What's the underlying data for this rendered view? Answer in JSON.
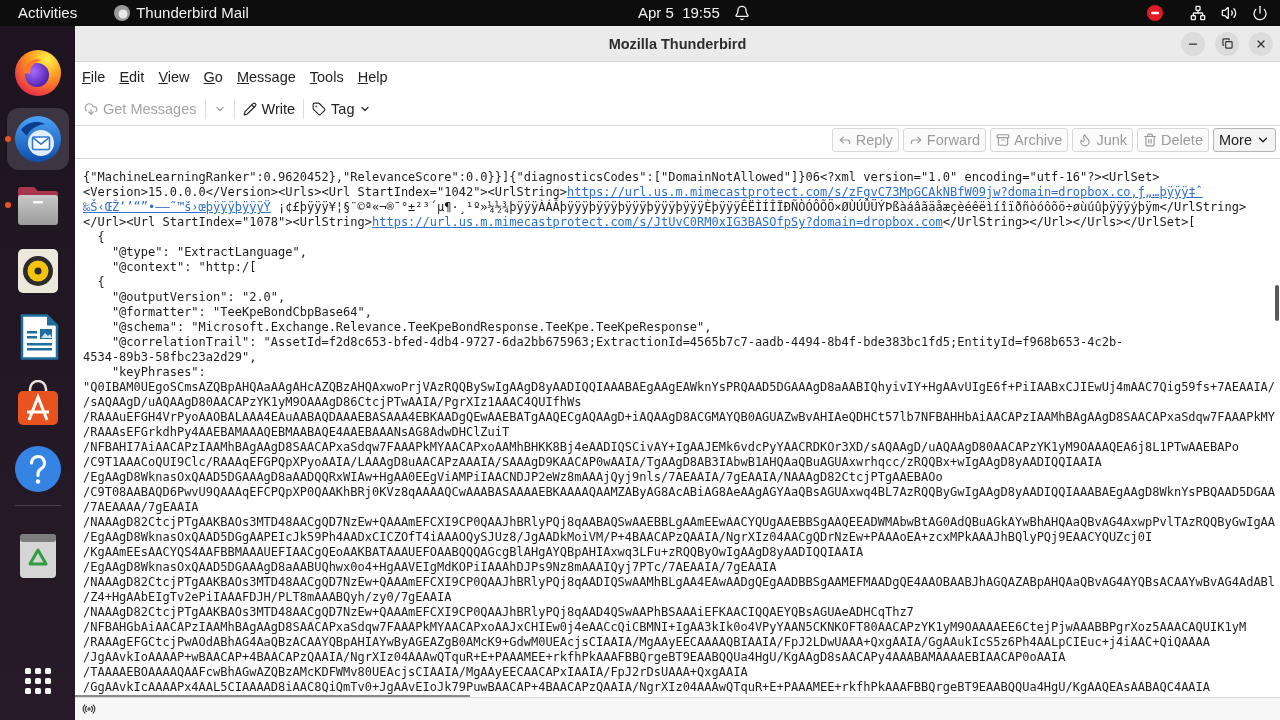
{
  "top_bar": {
    "activities": "Activities",
    "app_name": "Thunderbird Mail",
    "clock": "Apr 5  19:55"
  },
  "dock": {
    "items": [
      {
        "kind": "browser",
        "selected": false,
        "running": false
      },
      {
        "kind": "mail",
        "selected": true,
        "running": true
      },
      {
        "kind": "files",
        "selected": false,
        "running": true
      },
      {
        "kind": "music",
        "selected": false,
        "running": false
      },
      {
        "kind": "writer",
        "selected": false,
        "running": false
      },
      {
        "kind": "store",
        "selected": false,
        "running": false
      },
      {
        "kind": "help",
        "selected": false,
        "running": false
      },
      {
        "kind": "trash",
        "selected": false,
        "running": false
      }
    ]
  },
  "window": {
    "title": "Mozilla Thunderbird"
  },
  "menu_bar": [
    "File",
    "Edit",
    "View",
    "Go",
    "Message",
    "Tools",
    "Help"
  ],
  "toolbar": [
    {
      "kind": "get-messages",
      "label": "Get Messages",
      "disabled": true
    },
    {
      "kind": "write",
      "label": "Write",
      "disabled": false
    },
    {
      "kind": "tag",
      "label": "Tag",
      "disabled": false
    }
  ],
  "header_buttons": [
    {
      "kind": "reply",
      "label": "Reply",
      "disabled": true
    },
    {
      "kind": "forward",
      "label": "Forward",
      "disabled": true
    },
    {
      "kind": "archive",
      "label": "Archive",
      "disabled": true
    },
    {
      "kind": "junk",
      "label": "Junk",
      "disabled": true
    },
    {
      "kind": "delete",
      "label": "Delete",
      "disabled": true
    },
    {
      "kind": "more",
      "label": "More",
      "disabled": false
    }
  ],
  "message_body": {
    "lines": [
      {
        "parts": [
          {
            "kind": "text",
            "text": "{\"MachineLearningRanker\":0.9620452},\"RelevanceScore\":0.0}}]{\"diagnosticsCodes\":[\"DomainNotAllowed\"]}06<?xml version=\"1.0\" encoding=\"utf-16\"?><UrlSet>"
          }
        ]
      },
      {
        "parts": [
          {
            "kind": "text",
            "text": "<Version>15.0.0.0</Version><Urls><Url StartIndex=\"1042\"><UrlString>"
          },
          {
            "kind": "link",
            "text": "https://url.us.m.mimecastprotect.com/s/zFgvC73MpGCAkNBfW09jw?domain=dropbox.co‚ƒ„…þÿÿÿ‡ˆ"
          }
        ]
      },
      {
        "parts": [
          {
            "kind": "link",
            "text": "‰Š‹ŒŽ‘’“”•–—˜™š›œþÿÿÿþÿÿÿŸ"
          },
          {
            "kind": "text",
            "text": " ¡¢£þÿÿÿ¥¦§¨©ª«¬®¯°±²³´µ¶·¸¹º»¼½¾þÿÿÿÀÁÂþÿÿÿþÿÿÿþÿÿÿþÿÿÿþÿÿÿÈþÿÿÿÊËÌÍÎÏÐÑÒÓÔÕÖ×ØÙÚÛÜÝÞßàáâãäåæçèéêëìíîïðñòóôõö÷øùúûþÿÿÿýþÿm</UrlString>"
          }
        ]
      },
      {
        "parts": [
          {
            "kind": "text",
            "text": "</Url><Url StartIndex=\"1078\"><UrlString>"
          },
          {
            "kind": "link",
            "text": "https://url.us.m.mimecastprotect.com/s/JtUvC0RM0xIG3BASOfpSy?domain=dropbox.com"
          },
          {
            "kind": "text",
            "text": "</UrlString></Url></Urls></UrlSet>["
          }
        ]
      },
      {
        "parts": [
          {
            "kind": "text",
            "text": "  {"
          }
        ]
      },
      {
        "parts": [
          {
            "kind": "text",
            "text": "    \"@type\": \"ExtractLanguage\","
          }
        ]
      },
      {
        "parts": [
          {
            "kind": "text",
            "text": "    \"@context\": \"http:/["
          }
        ]
      },
      {
        "parts": [
          {
            "kind": "text",
            "text": "  {"
          }
        ]
      },
      {
        "parts": [
          {
            "kind": "text",
            "text": "    \"@outputVersion\": \"2.0\","
          }
        ]
      },
      {
        "parts": [
          {
            "kind": "text",
            "text": "    \"@formatter\": \"TeeKpeBondCbpBase64\","
          }
        ]
      },
      {
        "parts": [
          {
            "kind": "text",
            "text": "    \"@schema\": \"Microsoft.Exchange.Relevance.TeeKpeBondResponse.TeeKpe.TeeKpeResponse\","
          }
        ]
      },
      {
        "parts": [
          {
            "kind": "text",
            "text": "    \"@correlationTrail\": \"AssetId=f2d8c653-bfed-4db4-9727-6da2bb675963;ExtractionId=4565b7c7-aadb-4494-8b4f-bde383bc1fd5;EntityId=f968b653-4c2b-"
          }
        ]
      },
      {
        "parts": [
          {
            "kind": "text",
            "text": "4534-89b3-58fbc23a2d29\","
          }
        ]
      },
      {
        "parts": [
          {
            "kind": "text",
            "text": "    \"keyPhrases\":"
          }
        ]
      },
      {
        "parts": [
          {
            "kind": "text",
            "text": "\"Q0IBAM0UEgoSCmsAZQBpAHQAaAAgAHcAZQBzAHQAxwoPrjVAzRQQBySwIgAAgD8yAADIQQIAAABAEgAAgEAWknYsPRQAAD5DGAAAgD8aAABIQhyivIY+HgAAvUIgE6f+PiIAABxCJIEwUj4mAAC7Qig59fs+7AEAAIA/"
          }
        ]
      },
      {
        "parts": [
          {
            "kind": "text",
            "text": "/sAQAAgD/uAQAAgD80AACAPzYK1yM9OAAAgD86CtcjPTwAAIA/PgrXIz1AAAC4QUIfhWs"
          }
        ]
      },
      {
        "parts": [
          {
            "kind": "text",
            "text": "/RAAAuEFGH4VrPyoAAOBALAAA4EAuAABAQDAAAEBASAAA4EBKAADgQEwAAEBATgAAQECgAQAAgD+iAQAAgD8ACGMAYQB0AGUAZwBvAHIAeQDHCt57lb7NFBAHHbAiAACAPzIAAMhBAgAAgD8SAACAPxaSdqw7FAAAPkMY"
          }
        ]
      },
      {
        "parts": [
          {
            "kind": "text",
            "text": "/RAAAsEFGrkdhPy4AAEBAMAAAQEBMAABAQE4AAEBAAANsAG8AdwDHClZuiT"
          }
        ]
      },
      {
        "parts": [
          {
            "kind": "text",
            "text": "/NFBAHI7AiAACAPzIAAMhBAgAAgD8SAACAPxaSdqw7FAAAPkMYAACAPxoAAMhBHKK8Bj4eAADIQSCivAY+IgAAJEMk6vdcPyYAACRDKOr3XD/sAQAAgD/uAQAAgD80AACAPzYK1yM9OAAAQEA6j8L1PTwAAEBAPo"
          }
        ]
      },
      {
        "parts": [
          {
            "kind": "text",
            "text": "/C9T1AAACoQUI9Clc/RAAAqEFGPQpXPyoAAIA/LAAAgD8uAACAPzAAAIA/SAAAgD9KAACAP0wAAIA/TgAAgD8AB3IAbwB1AHQAaQBuAGUAxwrhqcc/zRQQBx+wIgAAgD8yAADIQQIAAIA"
          }
        ]
      },
      {
        "parts": [
          {
            "kind": "text",
            "text": "/EgAAgD8WknasOxQAAD5DGAAAgD8aAADQQRxWIAw+HgAA0EEgViAMPiIAACNDJP2eWz8mAAAjQyj9nls/7AEAAIA/7gEAAIA/NAAAgD82CtcjPTgAAEBAOo"
          }
        ]
      },
      {
        "parts": [
          {
            "kind": "text",
            "text": "/C9T08AABAQD6PwvU9QAAAqEFCPQpXP0QAAKhBRj0KVz8qAAAAQCwAAABASAAAAEBKAAAAQAAMZAByAG8AcABiAG8AeAAgAGYAaQBsAGUAxwq4BL7AzRQQByGwIgAAgD8yAADIQQIAAABAEgAAgD8WknYsPBQAAD5DGAA"
          }
        ]
      },
      {
        "parts": [
          {
            "kind": "text",
            "text": "/7AEAAAA/7gEAAIA"
          }
        ]
      },
      {
        "parts": [
          {
            "kind": "text",
            "text": "/NAAAgD82CtcjPTgAAKBAOs3MTD48AACgQD7NzEw+QAAAmEFCXI9CP0QAAJhBRlyPQj8qAABAQSwAAEBBLgAAmEEwAACYQUgAAEBBSgAAQEEADWMAbwBtAG0AdQBuAGkAYwBhAHQAaQBvAG4AxwpPvlTAzRQQByGwIgAA"
          }
        ]
      },
      {
        "parts": [
          {
            "kind": "text",
            "text": "/EgAAgD8WknasOxQAAD5DGgAAPEIcJk59Ph4AADxCICZOfT4iAAAOQySJUz8/JgAADkMoiVM/P+4BAACAPzQAAIA/NgrXIz04AACgQDrNzEw+PAAAoEA+zcxMPkAAAJhBQlyPQj9EAACYQUZcj0I"
          }
        ]
      },
      {
        "parts": [
          {
            "kind": "text",
            "text": "/KgAAmEEsAACYQS4AAFBBMAAAUEFIAACgQEoAAKBATAAAUEFOAABQQQAGcgBlAHgAYQBpAHIAxwq3LFu+zRQQByOwIgAAgD8yAADIQQIAAIA"
          }
        ]
      },
      {
        "parts": [
          {
            "kind": "text",
            "text": "/EgAAgD8WknasOxQAAD5DGAAAgD8aAABUQhwx0o4+HgAAVEIgMdKOPiIAAAhDJPs9Nz8mAAAIQyj7PTc/7AEAAIA/7gEAAIA"
          }
        ]
      },
      {
        "parts": [
          {
            "kind": "text",
            "text": "/NAAAgD82CtcjPTgAAKBAOs3MTD48AACgQD7NzEw+QAAAmEFCXI9CP0QAAJhBRlyPQj8qAADIQSwAAMhBLgAA4EAwAADgQEgAADBBSgAAMEFMAADgQE4AAOBAABJhAGQAZABpAHQAaQBvAG4AYQBsACAAYwBvAG4AdABl"
          }
        ]
      },
      {
        "parts": [
          {
            "kind": "text",
            "text": "/Z4+HgAAbEIgTv2ePiIAAAFDJH/PLT8mAAABQyh/zy0/7gEAAIA"
          }
        ]
      },
      {
        "parts": [
          {
            "kind": "text",
            "text": "/NAAAgD82CtcjPTgAAKBAOs3MTD48AACgQD7NzEw+QAAAmEFCXI9CP0QAAJhBRlyPQj8qAAD4QSwAAPhBSAAAiEFKAACIQQAEYQBsAGUAeADHCqThz7"
          }
        ]
      },
      {
        "parts": [
          {
            "kind": "text",
            "text": "/NFBAHGbAiAACAPzIAAMhBAgAAgD8SAACAPxaSdqw7FAAAPkMYAACAPxoAAJxCHIEw0j4eAACcQiCBMNI+IgAA3kIk0o4VPyYAAN5CKNKOFT80AACAPzYK1yM9OAAAAEE6CtejPjwAAABBPgrXoz5AAACAQUIK1yM"
          }
        ]
      },
      {
        "parts": [
          {
            "kind": "text",
            "text": "/RAAAgEFGCtcjPwAOdABhAG4AaQBzACAAYQBpAHIAYwByAGEAZgB0AMcK9+GdwM0UEAcjsCIAAIA/MgAAyEECAAAAQBIAAIA/FpJ2LDwUAAA+QxgAAIA/GgAAukIcS5z6Ph4AALpCIEuc+j4iAAC+QiQAAAA"
          }
        ]
      },
      {
        "parts": [
          {
            "kind": "text",
            "text": "/JgAAvkIoAAAAP+wBAACAP+4BAACAPzQAAIA/NgrXIz04AAAwQTquR+E+PAAAMEE+rkfhPkAAAFBBQrgeBT9EAABQQUa4HgU/KgAAgD8sAACAPy4AAABAMAAAAEBIAACAP0oAAIA"
          }
        ]
      },
      {
        "parts": [
          {
            "kind": "text",
            "text": "/TAAAAEBOAAAAQAAFcwBhAGwAZQBzAMcKDFWMv80UEAcjsCIAAIA/MgAAyEECAACAPxIAAIA/FpJ2rDsUAAA+QxgAAIA"
          }
        ]
      },
      {
        "parts": [
          {
            "kind": "text",
            "text": "/GgAAvkIcAAAAPx4AAL5CIAAAAD8iAAC8QiQmTv0+JgAAvEIoJk79PuwBAACAP+4BAACAPzQAAIA/NgrXIz04AAAwQTquR+E+PAAAMEE+rkfhPkAAAFBBQrgeBT9EAABQQUa4HgU/KgAAQEAsAABAQC4AAIA"
          }
        ]
      }
    ]
  }
}
